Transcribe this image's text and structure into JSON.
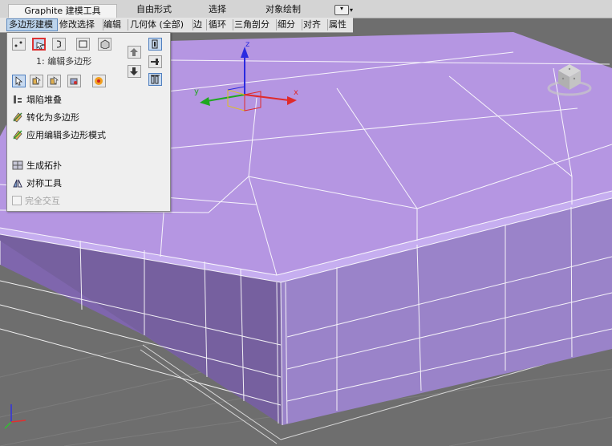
{
  "ribbon": {
    "tabs": [
      {
        "label": "Graphite 建模工具"
      },
      {
        "label": "自由形式"
      },
      {
        "label": "选择"
      },
      {
        "label": "对象绘制"
      }
    ],
    "toggle_icon": "expand-toggle-icon"
  },
  "panels": [
    {
      "label": "多边形建模"
    },
    {
      "label": "修改选择"
    },
    {
      "label": "编辑"
    },
    {
      "label": "几何体 (全部)"
    },
    {
      "label": "边"
    },
    {
      "label": "循环"
    },
    {
      "label": "三角剖分"
    },
    {
      "label": "细分"
    },
    {
      "label": "对齐"
    },
    {
      "label": "属性"
    }
  ],
  "dropdown": {
    "stack_label": "1: 编辑多边形",
    "subobject_buttons": [
      "vertex-icon",
      "edge-icon",
      "border-icon",
      "polygon-icon",
      "element-icon"
    ],
    "menu_items": [
      {
        "label": "塌陷堆叠",
        "icon": "collapse-stack-icon"
      },
      {
        "label": "转化为多边形",
        "icon": "convert-poly-icon"
      },
      {
        "label": "应用编辑多边形模式",
        "icon": "apply-edit-poly-icon"
      },
      {
        "label": "生成拓扑",
        "icon": "generate-topology-icon"
      },
      {
        "label": "对称工具",
        "icon": "symmetry-tools-icon"
      },
      {
        "label": "完全交互",
        "icon": "checkbox"
      }
    ]
  },
  "viewport": {
    "gizmo_labels": {
      "x": "x",
      "y": "y",
      "z": "z"
    },
    "colors": {
      "background": "#6e6e6e",
      "mesh_top": "#b596e2",
      "mesh_front": "#7f66ad",
      "mesh_side": "#9a83c9",
      "wire": "#ffffff",
      "selection_red": "#dd3333",
      "active_blue": "#4f7fbf"
    }
  }
}
